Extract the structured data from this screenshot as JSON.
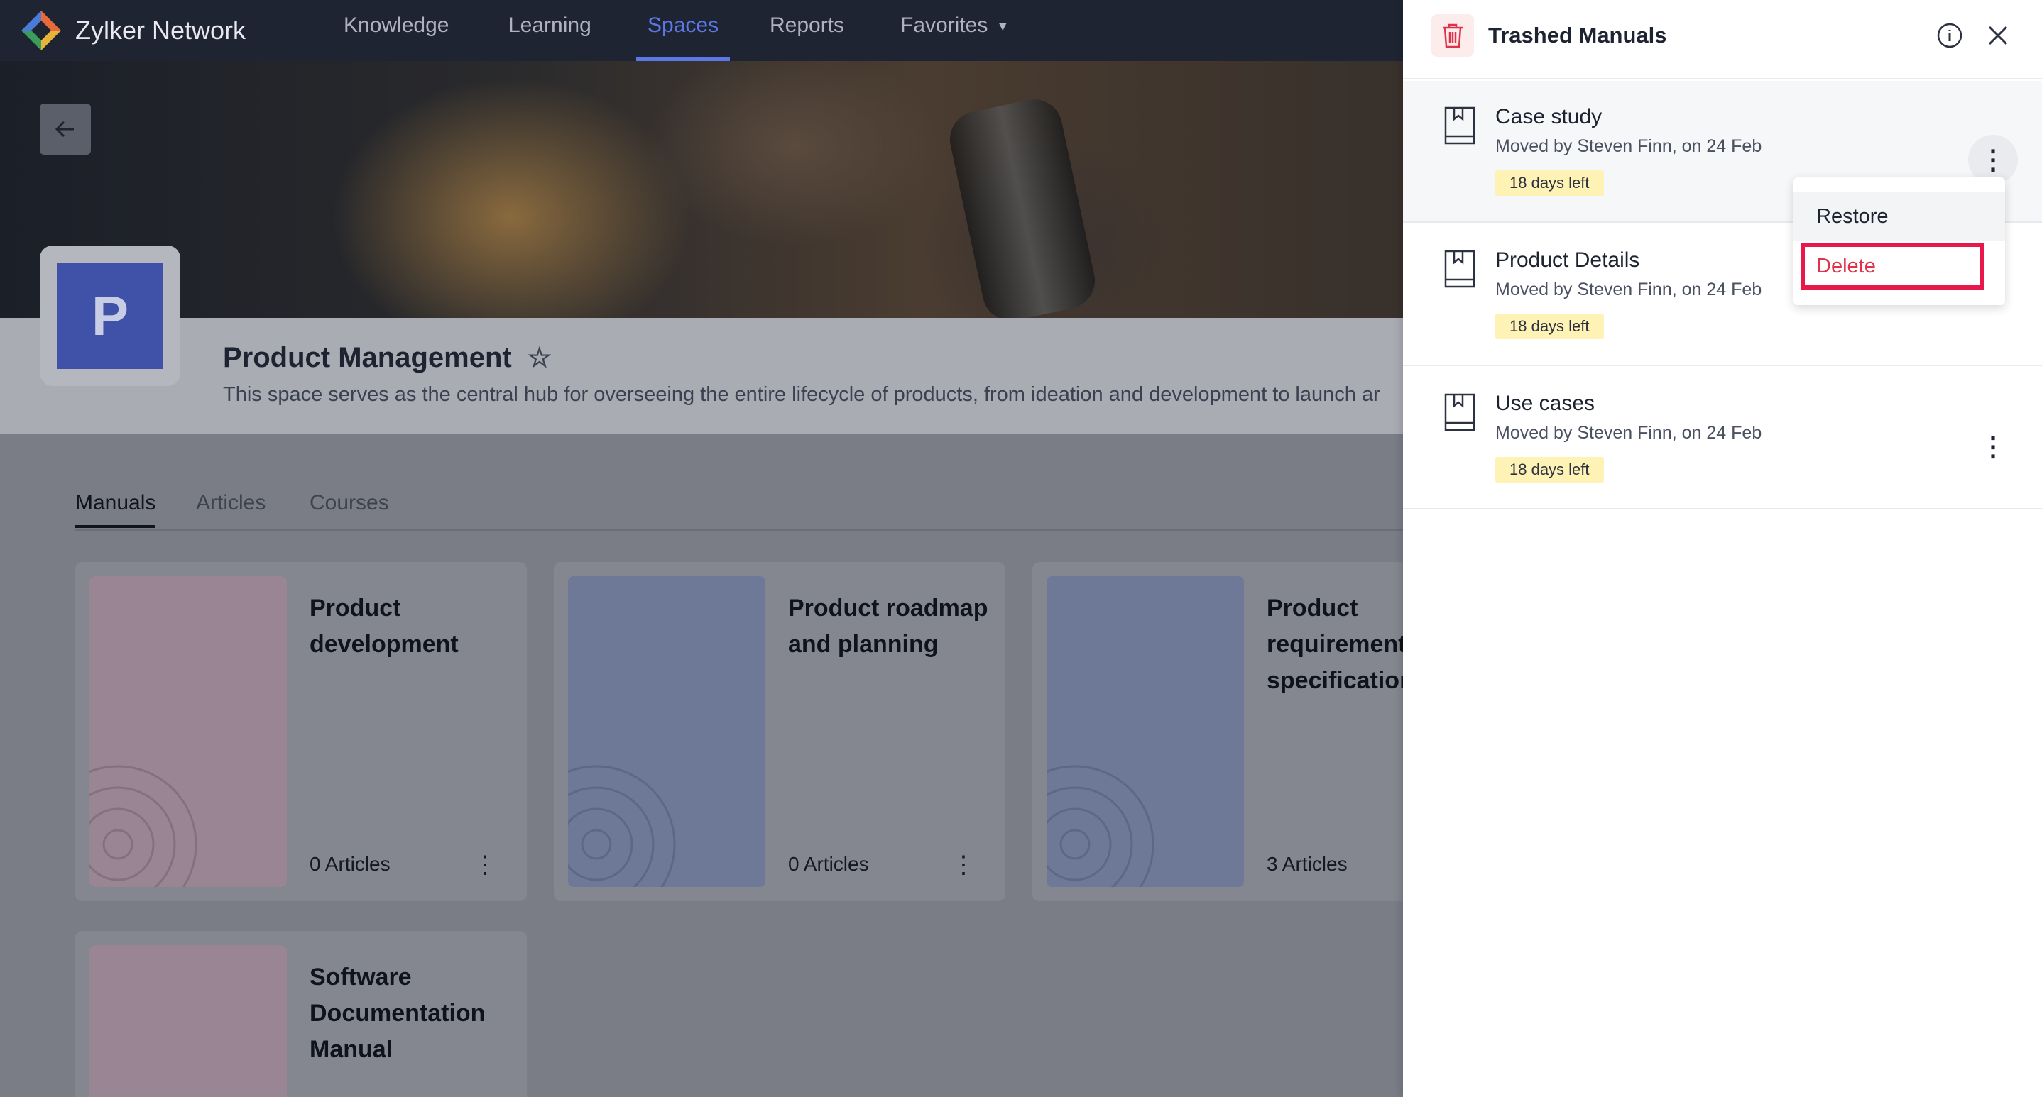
{
  "app": {
    "brand": "Zylker Network"
  },
  "nav": {
    "items": [
      {
        "label": "Knowledge",
        "active": false
      },
      {
        "label": "Learning",
        "active": false
      },
      {
        "label": "Spaces",
        "active": true
      },
      {
        "label": "Reports",
        "active": false
      },
      {
        "label": "Favorites",
        "active": false
      }
    ]
  },
  "space": {
    "initial": "P",
    "title": "Product Management",
    "description": "This space serves as the central hub for overseeing the entire lifecycle of products, from ideation and development to launch ar"
  },
  "tabs": [
    "Manuals",
    "Articles",
    "Courses"
  ],
  "active_tab": "Manuals",
  "cards": [
    {
      "title": "Product development",
      "count": "0 Articles",
      "cover_color": "#9a8594"
    },
    {
      "title": "Product roadmap and planning",
      "count": "0 Articles",
      "cover_color": "#6e7897"
    },
    {
      "title": "Product requirements specification",
      "count": "3 Articles",
      "cover_color": "#6e7897"
    },
    {
      "title": "Software Documentation Manual",
      "count": "",
      "cover_color": "#9a8594"
    }
  ],
  "drawer": {
    "title": "Trashed Manuals",
    "items": [
      {
        "name": "Case study",
        "meta": "Moved by Steven Finn, on 24 Feb",
        "badge": "18 days left"
      },
      {
        "name": "Product Details",
        "meta": "Moved by Steven Finn, on 24 Feb",
        "badge": "18 days left"
      },
      {
        "name": "Use cases",
        "meta": "Moved by Steven Finn, on 24 Feb",
        "badge": "18 days left"
      }
    ],
    "menu": {
      "restore": "Restore",
      "delete": "Delete"
    }
  },
  "colors": {
    "accent": "#5b78e6",
    "danger": "#e0334a",
    "badge_bg": "#fff2b5",
    "highlight": "#e8194a"
  }
}
